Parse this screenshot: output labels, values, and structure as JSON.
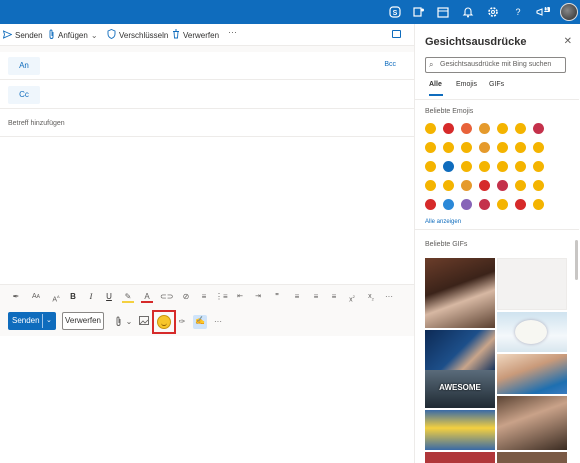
{
  "topbar": {
    "icons": [
      "skype-icon",
      "teams-icon",
      "calendar-icon",
      "bell-icon",
      "gear-icon",
      "help-icon",
      "megaphone-icon",
      "avatar"
    ],
    "notification_count": "11"
  },
  "toolbar": {
    "send_label": "Senden",
    "attach_label": "Anfügen",
    "encrypt_label": "Verschlüsseln",
    "discard_label": "Verwerfen",
    "more_label": "···"
  },
  "compose": {
    "to_label": "An",
    "cc_label": "Cc",
    "bcc_label": "Bcc",
    "subject_placeholder": "Betreff hinzufügen"
  },
  "format_bar": [
    "styles-icon",
    "font-size-icon",
    "grow-font-icon",
    "bold-icon",
    "italic-icon",
    "underline-icon",
    "highlight-icon",
    "font-color-icon",
    "link-icon",
    "unlink-icon",
    "align-icon",
    "bullets-icon",
    "numbering-icon",
    "decrease-indent-icon",
    "increase-indent-icon",
    "quote-icon",
    "align-left-icon",
    "align-center-icon",
    "align-right-icon",
    "superscript-icon",
    "subscript-icon",
    "more-icon"
  ],
  "action_bar": {
    "send_label": "Senden",
    "discard_label": "Verwerfen",
    "more_label": "···"
  },
  "panel": {
    "title": "Gesichtsausdrücke",
    "search_placeholder": "Gesichtsausdrücke mit Bing suchen",
    "tabs": [
      "Alle",
      "Emojis",
      "GIFs"
    ],
    "emoji_section": "Beliebte Emojis",
    "show_all": "Alle anzeigen",
    "gif_section": "Beliebte GIFs",
    "awesome_caption": "AWESOME",
    "emoji_colors": [
      "#f4b400",
      "#d62a2a",
      "#e8623a",
      "#e59a2c",
      "#f4b400",
      "#f4b400",
      "#c4314b",
      "#f4b400",
      "#f4b400",
      "#f4b400",
      "#e59a2c",
      "#f4b400",
      "#f4b400",
      "#f4b400",
      "#f4b400",
      "#0f6cbd",
      "#f4b400",
      "#f4b400",
      "#f4b400",
      "#f4b400",
      "#f4b400",
      "#f4b400",
      "#f4b400",
      "#e59a2c",
      "#d62a2a",
      "#c4314b",
      "#f4b400",
      "#f4b400",
      "#d62a2a",
      "#2b88d8",
      "#8764b8",
      "#c4314b",
      "#f4b400",
      "#d62a2a",
      "#f4b400"
    ]
  },
  "colors": {
    "brand": "#0f6cbd",
    "highlight_box": "#d62a2a"
  }
}
